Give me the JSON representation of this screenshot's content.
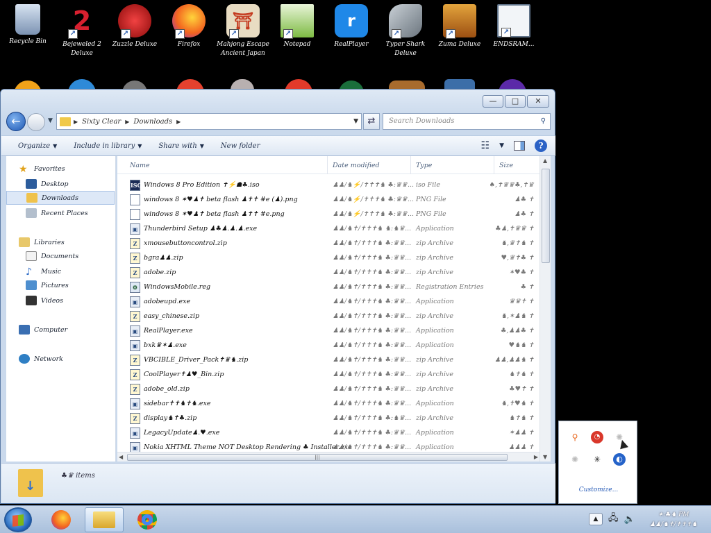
{
  "desktop": {
    "icons": [
      {
        "label": "Recycle Bin",
        "icon": "recycle-bin-icon",
        "color": "#8aa1c1"
      },
      {
        "label": "Bejeweled 2 Deluxe",
        "icon": "bejeweled-icon",
        "color": "#d8202f"
      },
      {
        "label": "Zuzzle Deluxe",
        "icon": "zuzzle-icon",
        "color": "#c9161d"
      },
      {
        "label": "Firefox",
        "icon": "firefox-icon",
        "color": "#f48b1e"
      },
      {
        "label": "Mahjong Escape Ancient Japan",
        "icon": "mahjong-icon",
        "color": "#c43a1f"
      },
      {
        "label": "Notepad",
        "icon": "notepad-icon",
        "color": "#7dbb43"
      },
      {
        "label": "RealPlayer",
        "icon": "realplayer-icon",
        "color": "#1f88e8"
      },
      {
        "label": "Typer Shark Deluxe",
        "icon": "typer-shark-icon",
        "color": "#9aa4ad"
      },
      {
        "label": "Zuma Deluxe",
        "icon": "zuma-icon",
        "color": "#c57a1c"
      },
      {
        "label": "ENDSRAM...",
        "icon": "window-app-icon",
        "color": "#dfe7ef"
      }
    ]
  },
  "window": {
    "caption_buttons": {
      "minimize": "—",
      "maximize": "□",
      "close": "✕"
    },
    "address": {
      "crumbs": [
        "Sixty Clear",
        "Downloads"
      ]
    },
    "search": {
      "placeholder": "Search Downloads"
    },
    "toolbar": {
      "organize": "Organize",
      "include": "Include in library",
      "share": "Share with",
      "new_folder": "New folder",
      "help": "?"
    },
    "navpane": {
      "favorites": "Favorites",
      "desktop": "Desktop",
      "downloads": "Downloads",
      "recent": "Recent Places",
      "libraries": "Libraries",
      "documents": "Documents",
      "music": "Music",
      "pictures": "Pictures",
      "videos": "Videos",
      "computer": "Computer",
      "network": "Network"
    },
    "columns": {
      "name": "Name",
      "date": "Date modified",
      "type": "Type",
      "size": "Size"
    },
    "files": [
      {
        "name": "Windows 8 Pro Edition ✝⚡☗♣.iso",
        "date": "♟♟/♞⚡/✝✝✝♞ ♣:♛♛...",
        "type": "iso File",
        "size": "♠,✝♛♛♣,✝♛"
      },
      {
        "name": "windows 8 ✶♥♟✝ beta flash ♟✝✝ #e (♟).png",
        "date": "♟♟/♞⚡/✝✝✝♞ ♣:♛♛...",
        "type": "PNG File",
        "size": "♟♣ ✝"
      },
      {
        "name": "windows 8 ✶♥♟✝ beta flash ♟✝✝ #e.png",
        "date": "♟♟/♞⚡/✝✝✝♞ ♣:♛♛...",
        "type": "PNG File",
        "size": "♟♣ ✝"
      },
      {
        "name": "Thunderbird Setup ♟♣♟.♟.♟.exe",
        "date": "♟♟/♞✝/✝✝✝♞ ♞:♞♛...",
        "type": "Application",
        "size": "♣♟,✝♛♛ ✝"
      },
      {
        "name": "xmousebuttoncontrol.zip",
        "date": "♟♟/♞✝/✝✝✝♞ ♣:♛♛...",
        "type": "zip Archive",
        "size": "♞,♛✝♞ ✝"
      },
      {
        "name": "bgra♟♟.zip",
        "date": "♟♟/♞✝/✝✝✝♞ ♣:♛♛...",
        "type": "zip Archive",
        "size": "♥,♛✝♣ ✝"
      },
      {
        "name": "adobe.zip",
        "date": "♟♟/♞✝/✝✝✝♞ ♣:♛♛...",
        "type": "zip Archive",
        "size": "✶♥♣ ✝"
      },
      {
        "name": "WindowsMobile.reg",
        "date": "♟♟/♞✝/✝✝✝♞ ♣:♛♛...",
        "type": "Registration Entries",
        "size": "♣ ✝"
      },
      {
        "name": "adobeupd.exe",
        "date": "♟♟/♞✝/✝✝✝♞ ♣:♛♛...",
        "type": "Application",
        "size": "♛♛✝ ✝"
      },
      {
        "name": "easy_chinese.zip",
        "date": "♟♟/♞✝/✝✝✝♞ ♣:♛♛...",
        "type": "zip Archive",
        "size": "♞,✶♟♞ ✝"
      },
      {
        "name": "RealPlayer.exe",
        "date": "♟♟/♞✝/✝✝✝♞ ♣:♛♛...",
        "type": "Application",
        "size": "♣,♟♟♣ ✝"
      },
      {
        "name": "bxk♛✶♟.exe",
        "date": "♟♟/♞✝/✝✝✝♞ ♣:♛♛...",
        "type": "Application",
        "size": "♥♞♞ ✝"
      },
      {
        "name": "VBCIBLE_Driver_Pack✝♛♞.zip",
        "date": "♟♟/♞✝/✝✝✝♞ ♣:♛♛...",
        "type": "zip Archive",
        "size": "♟♟,♟♟♞ ✝"
      },
      {
        "name": "CoolPlayer✝♟♥_Bin.zip",
        "date": "♟♟/♞✝/✝✝✝♞ ♣:♛♛...",
        "type": "zip Archive",
        "size": "♞✝♞ ✝"
      },
      {
        "name": "adobe_old.zip",
        "date": "♟♟/♞✝/✝✝✝♞ ♣:♛♛...",
        "type": "zip Archive",
        "size": "♣♥✝ ✝"
      },
      {
        "name": "sidebar✝✝♞✝♞.exe",
        "date": "♟♟/♞✝/✝✝✝♞ ♣:♛♛...",
        "type": "Application",
        "size": "♞,✝♥♞ ✝"
      },
      {
        "name": "display♞✝♣.zip",
        "date": "♟♟/♞✝/✝✝✝♞ ♣:♞♛...",
        "type": "zip Archive",
        "size": "♞✝♞ ✝"
      },
      {
        "name": "LegacyUpdate♟.♥.exe",
        "date": "♟♟/♞✝/✝✝✝♞ ♣:♛♛...",
        "type": "Application",
        "size": "✶♟♟ ✝"
      },
      {
        "name": "Nokia XHTML Theme NOT Desktop Rendering ♣ Installer.exe",
        "date": "♟♟/♞✝/✝✝✝♞ ♣:♛♛...",
        "type": "Application",
        "size": "♟♟♟ ✝"
      }
    ],
    "details": {
      "count": "♣♛ items"
    }
  },
  "tray_popup": {
    "customize": "Customize..."
  },
  "taskbar": {
    "clock_time": "✶:♣♞ PM",
    "clock_date": "♟♟/♞✝/✝✝✝♞"
  }
}
